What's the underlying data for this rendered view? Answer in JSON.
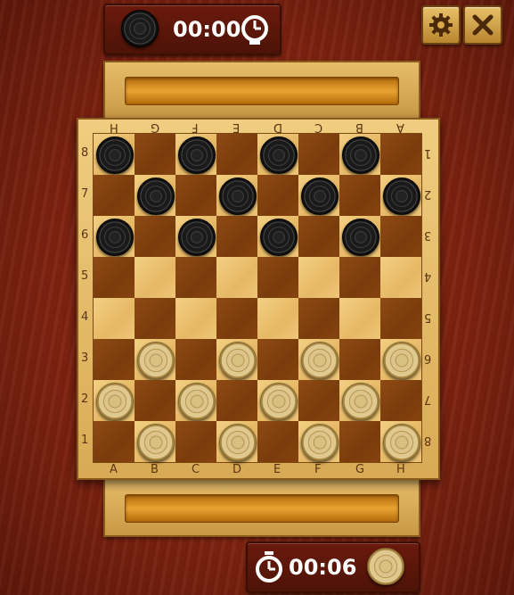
{
  "top_panel": {
    "timer": "00:00",
    "piece_color": "black"
  },
  "bottom_panel": {
    "timer": "00:06",
    "piece_color": "white"
  },
  "buttons": {
    "settings": "settings",
    "close": "close"
  },
  "board": {
    "files": [
      "A",
      "B",
      "C",
      "D",
      "E",
      "F",
      "G",
      "H"
    ],
    "ranks": [
      "8",
      "7",
      "6",
      "5",
      "4",
      "3",
      "2",
      "1"
    ],
    "top_files": [
      "H",
      "G",
      "F",
      "E",
      "D",
      "C",
      "B",
      "A"
    ],
    "right_ranks": [
      "1",
      "2",
      "3",
      "4",
      "5",
      "6",
      "7",
      "8"
    ],
    "layout": [
      "b.b.b.b.",
      ".b.b.b.b",
      "b.b.b.b.",
      "........",
      "........",
      ".w.w.w.w",
      "w.w.w.w.",
      ".w.w.w.w"
    ]
  }
}
